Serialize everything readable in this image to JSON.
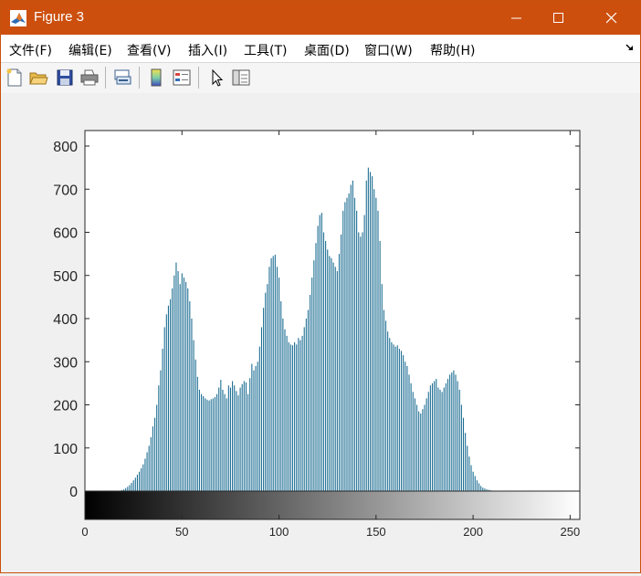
{
  "window": {
    "title": "Figure 3",
    "accent": "#cc4f0e",
    "controls": [
      "minimize-icon",
      "maximize-icon",
      "close-icon"
    ]
  },
  "menu": [
    {
      "label": "文件(F)"
    },
    {
      "label": "编辑(E)"
    },
    {
      "label": "查看(V)"
    },
    {
      "label": "插入(I)"
    },
    {
      "label": "工具(T)"
    },
    {
      "label": "桌面(D)"
    },
    {
      "label": "窗口(W)"
    },
    {
      "label": "帮助(H)"
    }
  ],
  "toolbar": [
    {
      "icon": "new-figure-icon"
    },
    {
      "icon": "open-file-icon"
    },
    {
      "icon": "save-icon"
    },
    {
      "icon": "print-icon"
    },
    {
      "icon": "link-plot-icon"
    },
    {
      "icon": "insert-colorbar-icon"
    },
    {
      "icon": "insert-legend-icon"
    },
    {
      "icon": "edit-plot-pointer-icon"
    },
    {
      "icon": "property-inspector-icon"
    }
  ],
  "chart_data": {
    "type": "bar",
    "bar_color": "#1f6f94",
    "xlim": [
      0,
      255
    ],
    "ylim": [
      -70,
      850
    ],
    "yticks": [
      0,
      100,
      200,
      300,
      400,
      500,
      600,
      700,
      800
    ],
    "xticks": [
      0,
      50,
      100,
      150,
      200,
      250
    ],
    "colorbar": "gray",
    "x_start": 0,
    "values": [
      0,
      0,
      0,
      0,
      0,
      0,
      0,
      0,
      0,
      0,
      0,
      0,
      0,
      0,
      0,
      0,
      0,
      0,
      1,
      2,
      4,
      7,
      10,
      14,
      19,
      25,
      31,
      38,
      45,
      53,
      62,
      75,
      90,
      105,
      125,
      150,
      170,
      200,
      245,
      280,
      330,
      380,
      410,
      430,
      445,
      470,
      500,
      530,
      510,
      480,
      505,
      495,
      485,
      470,
      440,
      400,
      350,
      305,
      265,
      235,
      225,
      220,
      215,
      212,
      210,
      213,
      215,
      218,
      225,
      240,
      258,
      235,
      225,
      215,
      245,
      240,
      255,
      245,
      232,
      222,
      240,
      248,
      255,
      252,
      225,
      262,
      295,
      280,
      290,
      300,
      335,
      380,
      425,
      460,
      480,
      520,
      540,
      545,
      548,
      520,
      495,
      440,
      400,
      375,
      360,
      345,
      340,
      338,
      345,
      340,
      355,
      350,
      360,
      380,
      400,
      420,
      455,
      495,
      535,
      575,
      615,
      640,
      645,
      600,
      580,
      560,
      545,
      540,
      530,
      520,
      510,
      550,
      595,
      650,
      670,
      680,
      690,
      710,
      720,
      680,
      650,
      600,
      590,
      600,
      640,
      720,
      750,
      740,
      730,
      700,
      680,
      650,
      580,
      480,
      420,
      395,
      370,
      355,
      345,
      340,
      335,
      338,
      330,
      325,
      315,
      300,
      290,
      270,
      250,
      230,
      215,
      200,
      185,
      180,
      190,
      200,
      215,
      230,
      245,
      250,
      255,
      260,
      240,
      235,
      230,
      240,
      250,
      260,
      270,
      275,
      280,
      270,
      255,
      235,
      200,
      170,
      135,
      105,
      80,
      60,
      45,
      35,
      25,
      18,
      12,
      8,
      6,
      4,
      3,
      2,
      1,
      1,
      1,
      0,
      0,
      0,
      0,
      0,
      0,
      0,
      0,
      0,
      0,
      0,
      0,
      0,
      0,
      0,
      0,
      0,
      0,
      0,
      0,
      0,
      0,
      0,
      0,
      0,
      0,
      0,
      0,
      0,
      0,
      0,
      0,
      0,
      0,
      0,
      0,
      0,
      0,
      0,
      0
    ]
  }
}
